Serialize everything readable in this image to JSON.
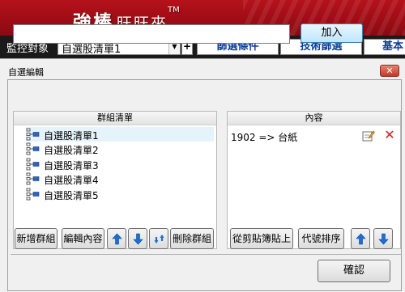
{
  "banner": {
    "brand_bold": "強棒",
    "brand_light": "旺旺來",
    "brand_tm": "TM"
  },
  "toolbar": {
    "label": "監控對象",
    "selected_list": "自選股清單1",
    "plus": "+",
    "tabs": [
      "篩選條件",
      "技術篩選",
      "基本"
    ]
  },
  "dialog": {
    "title": "自選編輯",
    "close_icon": "close-icon",
    "name_input_value": "",
    "add_label": "加入",
    "groups": {
      "header": "群組清單",
      "items": [
        "自選股清單1",
        "自選股清單2",
        "自選股清單3",
        "自選股清單4",
        "自選股清單5"
      ],
      "selected_index": 0,
      "buttons": {
        "new": "新增群組",
        "edit": "編輯內容",
        "delete": "刪除群組"
      },
      "icons": [
        "arrow-up-icon",
        "arrow-down-icon",
        "refresh-icon"
      ]
    },
    "content": {
      "header": "內容",
      "items": [
        {
          "text": "1902 => 台紙"
        }
      ],
      "buttons": {
        "paste": "從剪貼簿貼上",
        "sort": "代號排序"
      },
      "icons": [
        "edit-icon",
        "delete-icon",
        "arrow-up-icon",
        "arrow-down-icon"
      ]
    },
    "ok_label": "確認"
  },
  "colors": {
    "banner": "#b5121b",
    "toolbar": "#1a1a1a",
    "tab_text": "#0b3f99",
    "dialog_bg": "#f0f0f0",
    "delete": "#d21b1b",
    "arrow": "#1e6fd0"
  }
}
